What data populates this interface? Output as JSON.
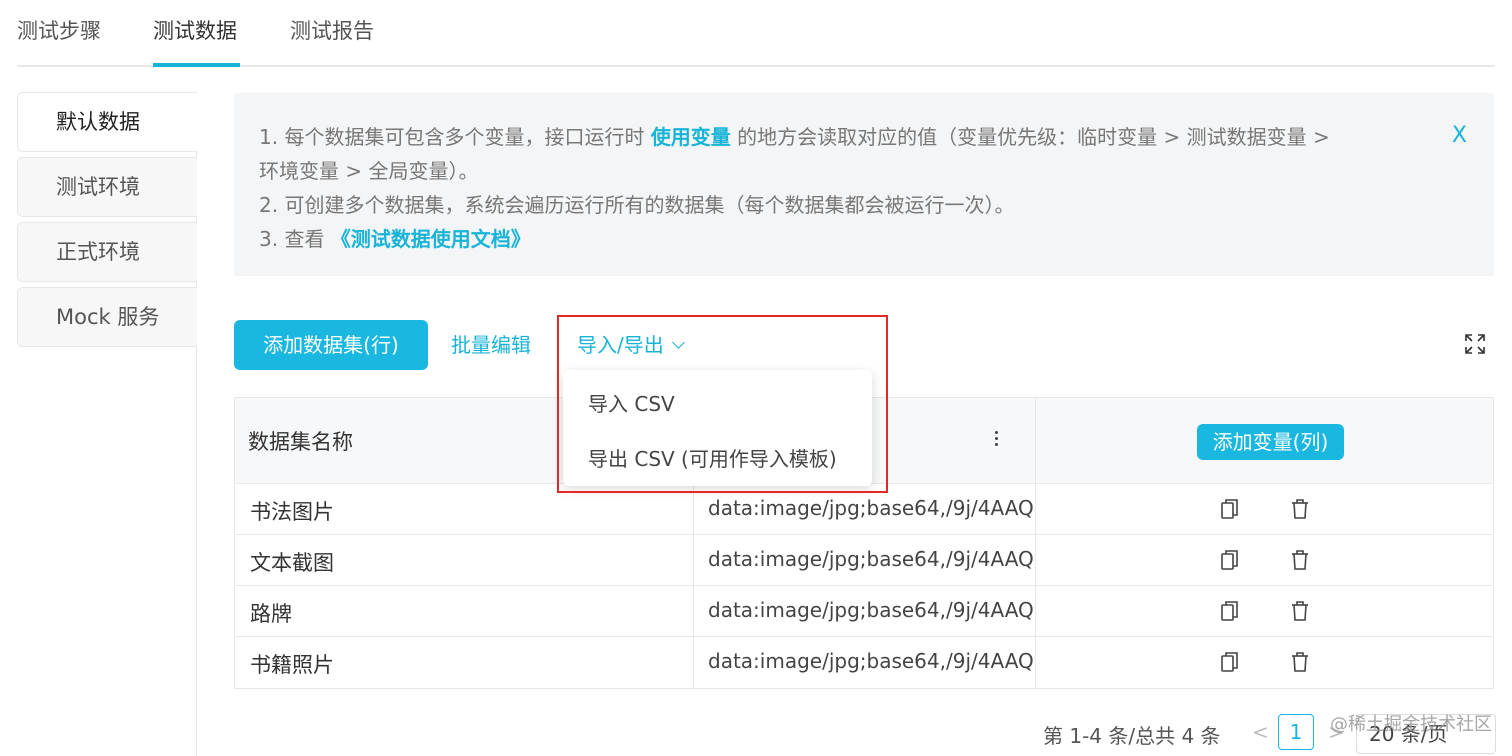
{
  "tabs": [
    {
      "label": "测试步骤",
      "active": false
    },
    {
      "label": "测试数据",
      "active": true
    },
    {
      "label": "测试报告",
      "active": false
    }
  ],
  "sidebar": {
    "items": [
      {
        "label": "默认数据",
        "active": true
      },
      {
        "label": "测试环境",
        "active": false
      },
      {
        "label": "正式环境",
        "active": false
      },
      {
        "label": "Mock 服务",
        "active": false
      }
    ]
  },
  "info": {
    "line1_prefix": "1. 每个数据集可包含多个变量，接口运行时 ",
    "line1_link": "使用变量",
    "line1_suffix": " 的地方会读取对应的值（变量优先级：临时变量 > 测试数据变量 >",
    "line1_cont": "环境变量 > 全局变量）。",
    "line2": "2. 可创建多个数据集，系统会遍历运行所有的数据集（每个数据集都会被运行一次）。",
    "line3_prefix": "3. 查看 ",
    "line3_link": "《测试数据使用文档》",
    "close_label": "X"
  },
  "toolbar": {
    "add_dataset_label": "添加数据集(行)",
    "batch_edit_label": "批量编辑",
    "import_export_label": "导入/导出"
  },
  "dropdown": {
    "items": [
      "导入 CSV",
      "导出 CSV (可用作导入模板)"
    ]
  },
  "table": {
    "header_name": "数据集名称",
    "add_variable_label": "添加变量(列)",
    "rows": [
      {
        "name": "书法图片",
        "value": "data:image/jpg;base64,/9j/4AAQ"
      },
      {
        "name": "文本截图",
        "value": "data:image/jpg;base64,/9j/4AAQ"
      },
      {
        "name": "路牌",
        "value": "data:image/jpg;base64,/9j/4AAQ"
      },
      {
        "name": "书籍照片",
        "value": "data:image/jpg;base64,/9j/4AAQ"
      }
    ]
  },
  "pagination": {
    "summary": "第 1-4 条/总共 4 条",
    "prev": "<",
    "current_page": "1",
    "next": ">",
    "page_size": "20 条/页"
  },
  "watermark": "@稀土掘金技术社区",
  "colors": {
    "accent": "#1ab8e0",
    "highlight": "#e02a2a"
  }
}
